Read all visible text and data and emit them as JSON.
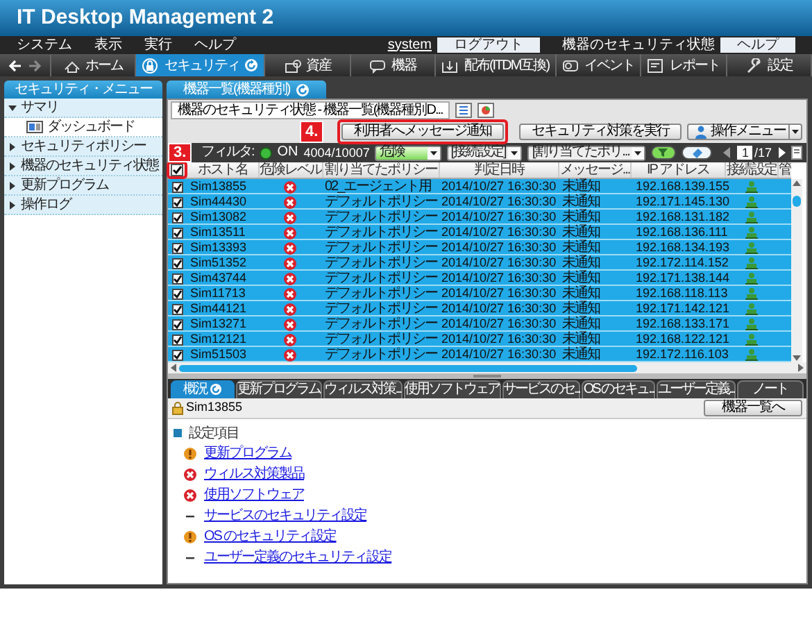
{
  "window": {
    "title": "IT Desktop Management 2"
  },
  "menu": [
    "システム",
    "表示",
    "実行",
    "ヘルプ"
  ],
  "account": {
    "user": "system",
    "logout": "ログアウト",
    "status_label": "機器のセキュリティ状態",
    "help": "ヘルプ"
  },
  "nav": [
    {
      "label": "ホーム",
      "selected": false
    },
    {
      "label": "セキュリティ",
      "selected": true
    },
    {
      "label": "資産",
      "selected": false
    },
    {
      "label": "機器",
      "selected": false
    },
    {
      "label": "配布(ITDM互換)",
      "selected": false
    },
    {
      "label": "イベント",
      "selected": false
    },
    {
      "label": "レポート",
      "selected": false
    },
    {
      "label": "設定",
      "selected": false
    }
  ],
  "sidebar": {
    "title": "セキュリティ・メニュー",
    "items": [
      {
        "label": "サマリ",
        "expanded": true,
        "children": [
          {
            "label": "ダッシュボード"
          }
        ]
      },
      {
        "label": "セキュリティポリシー",
        "expanded": false
      },
      {
        "label": "機器のセキュリティ状態",
        "expanded": false
      },
      {
        "label": "更新プログラム",
        "expanded": false
      },
      {
        "label": "操作ログ",
        "expanded": false
      }
    ]
  },
  "main_tab": {
    "label": "機器一覧(機器種別)"
  },
  "toolbar": {
    "title": "機器のセキュリティ状態 - 機器一覧(機器種別D...",
    "buttons": [
      "利用者へメッセージ通知",
      "セキュリティ対策を実行"
    ],
    "menu_button": "操作メニュー"
  },
  "filter": {
    "label": "フィルタ:",
    "on": true,
    "state_text": "ON",
    "count": "4004/10007",
    "dropdowns": [
      "危険",
      "[接続設定]",
      "[割り当てたポリ..."
    ]
  },
  "pager": {
    "page": "1",
    "total": "/17"
  },
  "table": {
    "header_checked": true,
    "columns": [
      "ホスト名",
      "危険レベル",
      "割り当てたポリシー",
      "判定日時",
      "メッセージ...",
      "IP アドレス",
      "接続設定",
      "管"
    ],
    "rows": [
      {
        "checked": true,
        "selected": true,
        "host": "Sim13855",
        "kind": "danger",
        "policy": "02_エージェント用",
        "date": "2014/10/27 16:30:30",
        "message": "未通知",
        "ip": "192.168.139.155"
      },
      {
        "checked": true,
        "selected": true,
        "host": "Sim44430",
        "kind": "danger",
        "policy": "デフォルトポリシー",
        "date": "2014/10/27 16:30:30",
        "message": "未通知",
        "ip": "192.171.145.130"
      },
      {
        "checked": true,
        "selected": true,
        "host": "Sim13082",
        "kind": "danger",
        "policy": "デフォルトポリシー",
        "date": "2014/10/27 16:30:30",
        "message": "未通知",
        "ip": "192.168.131.182"
      },
      {
        "checked": true,
        "selected": true,
        "host": "Sim13511",
        "kind": "danger",
        "policy": "デフォルトポリシー",
        "date": "2014/10/27 16:30:30",
        "message": "未通知",
        "ip": "192.168.136.111"
      },
      {
        "checked": true,
        "selected": true,
        "host": "Sim13393",
        "kind": "danger",
        "policy": "デフォルトポリシー",
        "date": "2014/10/27 16:30:30",
        "message": "未通知",
        "ip": "192.168.134.193"
      },
      {
        "checked": true,
        "selected": true,
        "host": "Sim51352",
        "kind": "danger",
        "policy": "デフォルトポリシー",
        "date": "2014/10/27 16:30:30",
        "message": "未通知",
        "ip": "192.172.114.152"
      },
      {
        "checked": true,
        "selected": true,
        "host": "Sim43744",
        "kind": "danger",
        "policy": "デフォルトポリシー",
        "date": "2014/10/27 16:30:30",
        "message": "未通知",
        "ip": "192.171.138.144"
      },
      {
        "checked": true,
        "selected": true,
        "host": "Sim11713",
        "kind": "danger",
        "policy": "デフォルトポリシー",
        "date": "2014/10/27 16:30:30",
        "message": "未通知",
        "ip": "192.168.118.113"
      },
      {
        "checked": true,
        "selected": true,
        "host": "Sim44121",
        "kind": "danger",
        "policy": "デフォルトポリシー",
        "date": "2014/10/27 16:30:30",
        "message": "未通知",
        "ip": "192.171.142.121"
      },
      {
        "checked": true,
        "selected": true,
        "host": "Sim13271",
        "kind": "danger",
        "policy": "デフォルトポリシー",
        "date": "2014/10/27 16:30:30",
        "message": "未通知",
        "ip": "192.168.133.171"
      },
      {
        "checked": true,
        "selected": true,
        "host": "Sim12121",
        "kind": "danger",
        "policy": "デフォルトポリシー",
        "date": "2014/10/27 16:30:30",
        "message": "未通知",
        "ip": "192.168.122.121"
      },
      {
        "checked": true,
        "selected": true,
        "host": "Sim51503",
        "kind": "danger",
        "policy": "デフォルトポリシー",
        "date": "2014/10/27 16:30:30",
        "message": "未通知",
        "ip": "192.172.116.103"
      }
    ]
  },
  "detail_tabs": [
    {
      "label": "概況",
      "selected": true
    },
    {
      "label": "更新プログラム",
      "selected": false
    },
    {
      "label": "ウィルス対策...",
      "selected": false
    },
    {
      "label": "使用ソフトウェア",
      "selected": false
    },
    {
      "label": "サービスのセ...",
      "selected": false
    },
    {
      "label": "OS のセキュ...",
      "selected": false
    },
    {
      "label": "ユーザー定義...",
      "selected": false
    },
    {
      "label": "ノート",
      "selected": false
    }
  ],
  "detail": {
    "host": "Sim13855",
    "button": "機器一覧へ",
    "section": "設定項目",
    "items": [
      {
        "kind": "warning",
        "label": "更新プログラム"
      },
      {
        "kind": "danger",
        "label": "ウィルス対策製品"
      },
      {
        "kind": "danger",
        "label": "使用ソフトウェア"
      },
      {
        "kind": "none",
        "label": "サービスのセキュリティ設定"
      },
      {
        "kind": "warning",
        "label": "OS のセキュリティ設定"
      },
      {
        "kind": "none",
        "label": "ユーザー定義のセキュリティ設定"
      }
    ]
  },
  "callouts": [
    {
      "label": "3."
    },
    {
      "label": "4."
    }
  ]
}
